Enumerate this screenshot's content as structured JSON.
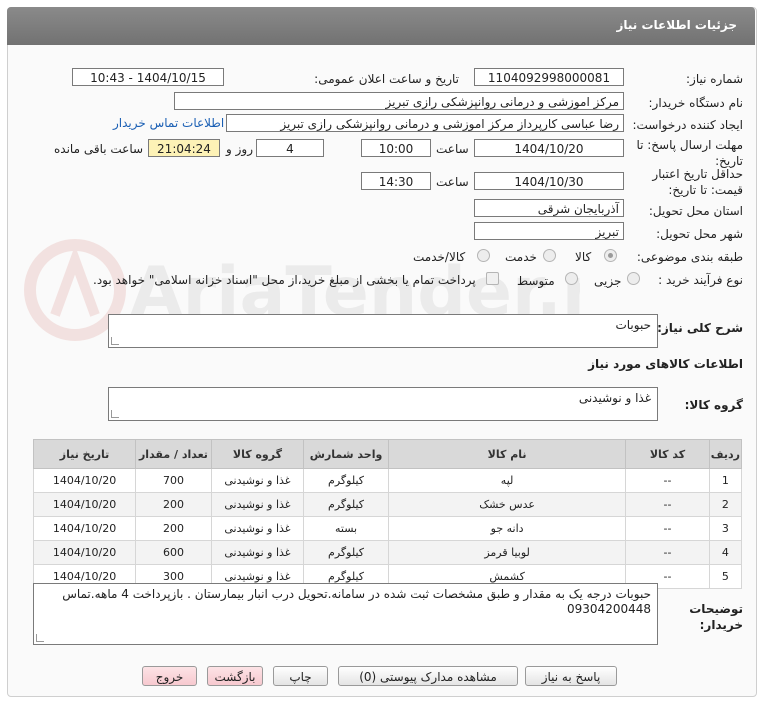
{
  "header": {
    "title": "جزئیات اطلاعات نیاز"
  },
  "fields": {
    "need_number_label": "شماره نیاز:",
    "need_number": "1104092998000081",
    "announce_label": "تاریخ و ساعت اعلان عمومی:",
    "announce_value": "1404/10/15 - 10:43",
    "buyer_org_label": "نام دستگاه خریدار:",
    "buyer_org": "مرکز اموزشی و درمانی روانپزشکی رازی تبریز",
    "requester_label": "ایجاد کننده درخواست:",
    "requester": "رضا عباسی کارپرداز مرکز اموزشی و درمانی روانپزشکی رازی تبریز",
    "contact_link": "اطلاعات تماس خریدار",
    "deadline_label": "مهلت ارسال پاسخ: تا تاریخ:",
    "deadline_date": "1404/10/20",
    "time_label": "ساعت",
    "deadline_time": "10:00",
    "days": "4",
    "days_label": "روز و",
    "remaining": "21:04:24",
    "remaining_label": "ساعت باقی مانده",
    "validity_label": "حداقل تاریخ اعتبار قیمت: تا تاریخ:",
    "validity_date": "1404/10/30",
    "validity_time": "14:30",
    "province_label": "استان محل تحویل:",
    "province": "آذربایجان شرقی",
    "city_label": "شهر محل تحویل:",
    "city": "تبریز",
    "category_label": "طبقه بندی موضوعی:",
    "category_options": [
      "کالا",
      "خدمت",
      "کالا/خدمت"
    ],
    "process_label": "نوع فرآیند خرید :",
    "process_options": [
      "جزیی",
      "متوسط"
    ],
    "payment_note": "پرداخت تمام یا بخشی از مبلغ خرید،از محل \"اسناد خزانه اسلامی\" خواهد بود."
  },
  "summary": {
    "label": "شرح کلی نیاز:",
    "value": "حبوبات"
  },
  "goods_section": {
    "title": "اطلاعات کالاهای مورد نیاز",
    "group_label": "گروه کالا:",
    "group_value": "غذا و نوشیدنی"
  },
  "table": {
    "headers": [
      "ردیف",
      "کد کالا",
      "نام کالا",
      "واحد شمارش",
      "گروه کالا",
      "تعداد / مقدار",
      "تاریخ نیاز"
    ],
    "rows": [
      [
        "1",
        "--",
        "لپه",
        "کیلوگرم",
        "غذا و نوشیدنی",
        "700",
        "1404/10/20"
      ],
      [
        "2",
        "--",
        "عدس خشک",
        "کیلوگرم",
        "غذا و نوشیدنی",
        "200",
        "1404/10/20"
      ],
      [
        "3",
        "--",
        "دانه جو",
        "بسته",
        "غذا و نوشیدنی",
        "200",
        "1404/10/20"
      ],
      [
        "4",
        "--",
        "لوبیا قرمز",
        "کیلوگرم",
        "غذا و نوشیدنی",
        "600",
        "1404/10/20"
      ],
      [
        "5",
        "--",
        "کشمش",
        "کیلوگرم",
        "غذا و نوشیدنی",
        "300",
        "1404/10/20"
      ]
    ]
  },
  "buyer_notes": {
    "label": "توضیحات خریدار:",
    "value": "حبوبات درجه یک به مقدار و طبق مشخصات ثبت شده در سامانه.تحویل درب انبار بیمارستان . بازپرداخت 4 ماهه.تماس 09304200448"
  },
  "buttons": {
    "reply": "پاسخ به نیاز",
    "attachments": "مشاهده مدارک پیوستی (0)",
    "print": "چاپ",
    "back": "بازگشت",
    "exit": "خروج"
  },
  "watermark": "AriaTender.net"
}
